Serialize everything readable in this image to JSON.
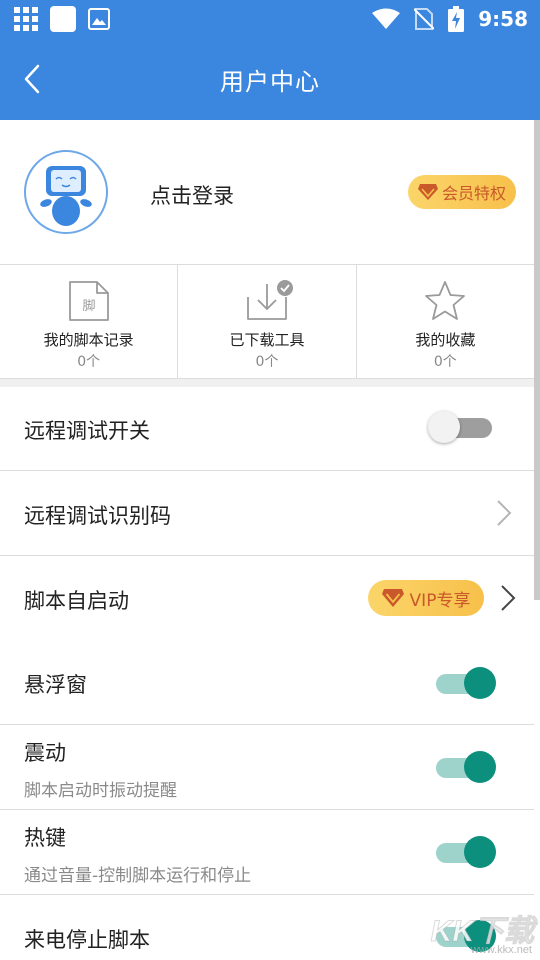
{
  "status_bar": {
    "time": "9:58",
    "left_icons": [
      "grid-icon",
      "square-icon",
      "image-icon"
    ],
    "right_icons": [
      "wifi-icon",
      "no-sim-icon",
      "battery-charging-icon"
    ]
  },
  "app_bar": {
    "title": "用户中心",
    "back_icon": "back-arrow-icon"
  },
  "profile": {
    "login_text": "点击登录",
    "vip_badge_label": "会员特权"
  },
  "stats": [
    {
      "label": "我的脚本记录",
      "count": "0个",
      "icon": "script-file-icon",
      "icon_text": "脚"
    },
    {
      "label": "已下载工具",
      "count": "0个",
      "icon": "download-tray-icon"
    },
    {
      "label": "我的收藏",
      "count": "0个",
      "icon": "star-icon"
    }
  ],
  "settings": {
    "remote_debug_switch": {
      "title": "远程调试开关",
      "enabled": false
    },
    "remote_debug_code": {
      "title": "远程调试识别码"
    },
    "script_autostart": {
      "title": "脚本自启动",
      "vip_label": "VIP专享"
    },
    "floating_window": {
      "title": "悬浮窗",
      "enabled": true
    },
    "vibration": {
      "title": "震动",
      "subtitle": "脚本启动时振动提醒",
      "enabled": true
    },
    "hotkey": {
      "title": "热键",
      "subtitle": "通过音量-控制脚本运行和停止",
      "enabled": true
    },
    "stop_on_call": {
      "title": "来电停止脚本",
      "enabled": true
    }
  },
  "watermark": {
    "logo": "KK下载",
    "url": "www.kkx.net"
  },
  "colors": {
    "primary": "#3b87e0",
    "toggle_on": "#0d8f7e",
    "toggle_on_track": "#9ed3cc",
    "vip_gold": "#f7c04a",
    "vip_text": "#c9582a"
  }
}
